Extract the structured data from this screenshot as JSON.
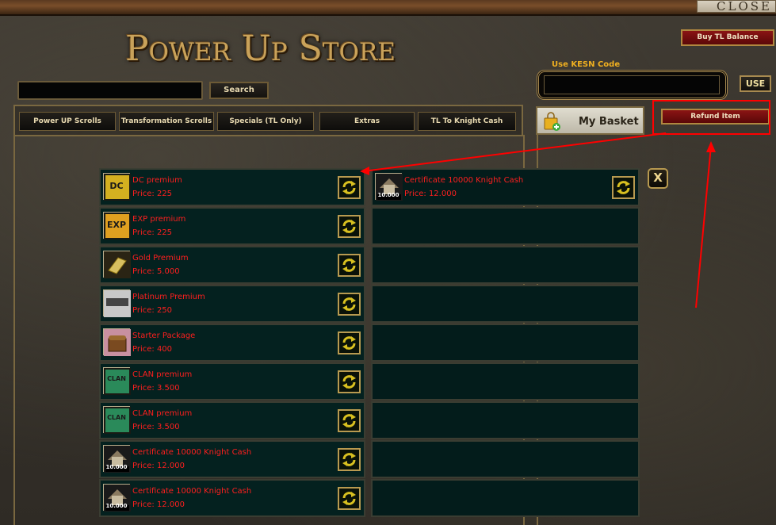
{
  "header": {
    "title": "Power Up Store",
    "close_label": "CLOSE",
    "buy_balance_label": "Buy TL Balance"
  },
  "search": {
    "value": "",
    "button_label": "Search"
  },
  "kesn": {
    "label": "Use KESN Code",
    "value": "",
    "use_label": "USE"
  },
  "tabs": [
    {
      "label": "Power UP Scrolls"
    },
    {
      "label": "Transformation Scrolls"
    },
    {
      "label": "Specials (TL Only)"
    },
    {
      "label": "Extras"
    },
    {
      "label": "TL To Knight Cash"
    }
  ],
  "basket": {
    "label": "My Basket",
    "refund_label": "Refund Item",
    "close_label": "X"
  },
  "items": [
    {
      "name": "DC premium",
      "price": "Price: 225",
      "icon": "dc-premium-icon",
      "icon_text": "DC",
      "icon_color": "#d4b020"
    },
    {
      "name": "EXP premium",
      "price": "Price: 225",
      "icon": "exp-premium-icon",
      "icon_text": "EXP",
      "icon_color": "#e0a020"
    },
    {
      "name": "Gold Premium",
      "price": "Price: 5.000",
      "icon": "gold-premium-icon",
      "icon_text": "",
      "icon_color": "#d8c060"
    },
    {
      "name": "Platinum Premium",
      "price": "Price: 250",
      "icon": "platinum-premium-icon",
      "icon_text": "",
      "icon_color": "#9a9a9a"
    },
    {
      "name": "Starter Package",
      "price": "Price: 400",
      "icon": "starter-package-icon",
      "icon_text": "",
      "icon_color": "#a0605a"
    },
    {
      "name": "CLAN premium",
      "price": "Price: 3.500",
      "icon": "clan-premium-icon",
      "icon_text": "CLAN",
      "icon_color": "#2a8a5a"
    },
    {
      "name": "CLAN premium",
      "price": "Price: 3.500",
      "icon": "clan-premium-icon",
      "icon_text": "CLAN",
      "icon_color": "#2a8a5a"
    },
    {
      "name": "Certificate 10000 Knight Cash",
      "price": "Price: 12.000",
      "icon": "knight-cash-certificate-icon",
      "icon_text": "10.000",
      "icon_color": "#6a6a6a"
    },
    {
      "name": "Certificate 10000 Knight Cash",
      "price": "Price: 12.000",
      "icon": "knight-cash-certificate-icon",
      "icon_text": "10.000",
      "icon_color": "#6a6a6a"
    }
  ],
  "basket_items": [
    {
      "name": "Certificate 10000 Knight Cash",
      "price": "Price: 12.000",
      "icon": "knight-cash-certificate-icon",
      "icon_text": "10.000",
      "icon_color": "#6a6a6a"
    }
  ],
  "basket_empty_slots": 8,
  "colors": {
    "item_text": "#ff1f1f",
    "accent_gold": "#c9a25a",
    "annotation": "#ff0000"
  }
}
